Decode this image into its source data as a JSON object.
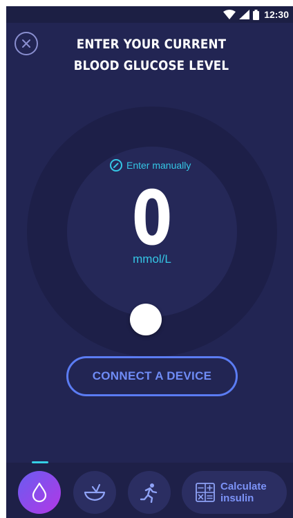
{
  "status_bar": {
    "time": "12:30"
  },
  "header": {
    "title_line1": "ENTER YOUR CURRENT",
    "title_line2": "BLOOD GLUCOSE LEVEL"
  },
  "glucose": {
    "enter_manually_label": "Enter manually",
    "value": "0",
    "unit": "mmol/L"
  },
  "actions": {
    "connect_device_label": "CONNECT A DEVICE"
  },
  "bottom_nav": {
    "items": [
      {
        "icon": "drop-icon",
        "active": true
      },
      {
        "icon": "bowl-icon",
        "active": false
      },
      {
        "icon": "running-icon",
        "active": false
      }
    ],
    "calculate_label_line1": "Calculate",
    "calculate_label_line2": "insulin"
  },
  "colors": {
    "background": "#222553",
    "accent_cyan": "#35c7e6",
    "accent_blue": "#5b7cf3",
    "active_gradient_start": "#6a5cf0",
    "active_gradient_end": "#b238e6"
  }
}
